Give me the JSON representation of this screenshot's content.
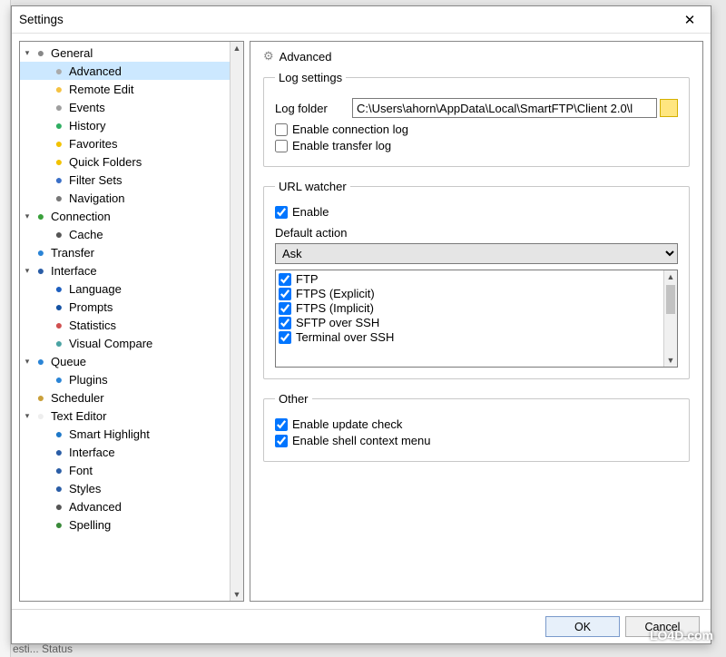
{
  "window": {
    "title": "Settings",
    "close_glyph": "✕"
  },
  "tree": [
    {
      "level": 0,
      "twisty": "▾",
      "icon_color": "#888",
      "icon_name": "gear-icon",
      "label": "General"
    },
    {
      "level": 1,
      "twisty": "",
      "icon_color": "#aaa",
      "icon_name": "gear-small-icon",
      "label": "Advanced",
      "selected": true
    },
    {
      "level": 1,
      "twisty": "",
      "icon_color": "#f5c242",
      "icon_name": "pencil-icon",
      "label": "Remote Edit"
    },
    {
      "level": 1,
      "twisty": "",
      "icon_color": "#9e9e9e",
      "icon_name": "events-icon",
      "label": "Events"
    },
    {
      "level": 1,
      "twisty": "",
      "icon_color": "#2fae62",
      "icon_name": "history-icon",
      "label": "History"
    },
    {
      "level": 1,
      "twisty": "",
      "icon_color": "#f2c200",
      "icon_name": "star-icon",
      "label": "Favorites"
    },
    {
      "level": 1,
      "twisty": "",
      "icon_color": "#f2c200",
      "icon_name": "quick-folders-icon",
      "label": "Quick Folders"
    },
    {
      "level": 1,
      "twisty": "",
      "icon_color": "#3a6fc7",
      "icon_name": "filter-sets-icon",
      "label": "Filter Sets"
    },
    {
      "level": 1,
      "twisty": "",
      "icon_color": "#777",
      "icon_name": "navigation-icon",
      "label": "Navigation"
    },
    {
      "level": 0,
      "twisty": "▾",
      "icon_color": "#39a03b",
      "icon_name": "connection-icon",
      "label": "Connection"
    },
    {
      "level": 1,
      "twisty": "",
      "icon_color": "#555",
      "icon_name": "cache-icon",
      "label": "Cache"
    },
    {
      "level": 0,
      "twisty": "",
      "icon_color": "#2a84d6",
      "icon_name": "transfer-icon",
      "label": "Transfer"
    },
    {
      "level": 0,
      "twisty": "▾",
      "icon_color": "#2a5da6",
      "icon_name": "interface-icon",
      "label": "Interface"
    },
    {
      "level": 1,
      "twisty": "",
      "icon_color": "#1e5fbf",
      "icon_name": "language-icon",
      "label": "Language"
    },
    {
      "level": 1,
      "twisty": "",
      "icon_color": "#1552a3",
      "icon_name": "prompts-icon",
      "label": "Prompts"
    },
    {
      "level": 1,
      "twisty": "",
      "icon_color": "#d05050",
      "icon_name": "statistics-icon",
      "label": "Statistics"
    },
    {
      "level": 1,
      "twisty": "",
      "icon_color": "#4aa3a3",
      "icon_name": "visual-compare-icon",
      "label": "Visual Compare"
    },
    {
      "level": 0,
      "twisty": "▾",
      "icon_color": "#2a84d6",
      "icon_name": "queue-icon",
      "label": "Queue"
    },
    {
      "level": 1,
      "twisty": "",
      "icon_color": "#2a84d6",
      "icon_name": "plugins-icon",
      "label": "Plugins"
    },
    {
      "level": 0,
      "twisty": "",
      "icon_color": "#caa03a",
      "icon_name": "scheduler-icon",
      "label": "Scheduler"
    },
    {
      "level": 0,
      "twisty": "▾",
      "icon_color": "#eee",
      "icon_name": "text-editor-icon",
      "label": "Text Editor"
    },
    {
      "level": 1,
      "twisty": "",
      "icon_color": "#1e78c8",
      "icon_name": "smart-highlight-icon",
      "label": "Smart Highlight"
    },
    {
      "level": 1,
      "twisty": "",
      "icon_color": "#2a5da6",
      "icon_name": "interface-sub-icon",
      "label": "Interface"
    },
    {
      "level": 1,
      "twisty": "",
      "icon_color": "#2a5da6",
      "icon_name": "font-icon",
      "label": "Font"
    },
    {
      "level": 1,
      "twisty": "",
      "icon_color": "#2a5da6",
      "icon_name": "styles-icon",
      "label": "Styles"
    },
    {
      "level": 1,
      "twisty": "",
      "icon_color": "#555",
      "icon_name": "advanced-sub-icon",
      "label": "Advanced"
    },
    {
      "level": 1,
      "twisty": "",
      "icon_color": "#3a8a3a",
      "icon_name": "spelling-icon",
      "label": "Spelling"
    }
  ],
  "page": {
    "heading_icon": "⚙",
    "heading": "Advanced",
    "log_settings": {
      "legend": "Log settings",
      "log_folder_label": "Log folder",
      "log_folder_value": "C:\\Users\\ahorn\\AppData\\Local\\SmartFTP\\Client 2.0\\l",
      "enable_connection_log": {
        "label": "Enable connection log",
        "checked": false
      },
      "enable_transfer_log": {
        "label": "Enable transfer log",
        "checked": false
      }
    },
    "url_watcher": {
      "legend": "URL watcher",
      "enable": {
        "label": "Enable",
        "checked": true
      },
      "default_action_label": "Default action",
      "default_action_value": "Ask",
      "protocols": [
        {
          "label": "FTP",
          "checked": true
        },
        {
          "label": "FTPS (Explicit)",
          "checked": true
        },
        {
          "label": "FTPS (Implicit)",
          "checked": true
        },
        {
          "label": "SFTP over SSH",
          "checked": true
        },
        {
          "label": "Terminal over SSH",
          "checked": true
        }
      ]
    },
    "other": {
      "legend": "Other",
      "enable_update_check": {
        "label": "Enable update check",
        "checked": true
      },
      "enable_shell_context_menu": {
        "label": "Enable shell context menu",
        "checked": true
      }
    }
  },
  "footer": {
    "ok": "OK",
    "cancel": "Cancel"
  },
  "watermark": "LO4D.com",
  "bg_status": "esti...  Status"
}
